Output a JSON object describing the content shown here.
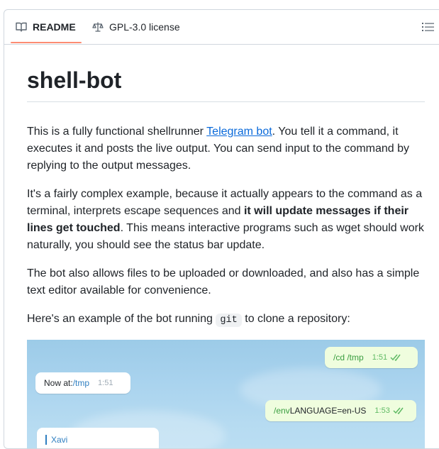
{
  "tabs": [
    {
      "label": "README",
      "icon": "book-icon",
      "active": true
    },
    {
      "label": "GPL-3.0 license",
      "icon": "scale-icon",
      "active": false
    }
  ],
  "toc_icon": "list-icon",
  "colors": {
    "accent_underline": "#fd8c73",
    "link": "#0969da",
    "text": "#1f2328"
  },
  "readme": {
    "title": "shell-bot",
    "p1": {
      "before": "This is a fully functional shellrunner ",
      "link": "Telegram bot",
      "after": ". You tell it a command, it executes it and posts the live output. You can send input to the command by replying to the output messages."
    },
    "p2": {
      "before": "It's a fairly complex example, because it actually appears to the command as a terminal, interprets escape sequences and ",
      "bold": "it will update messages if their lines get touched",
      "after": ". This means interactive programs such as wget should work naturally, you should see the status bar update."
    },
    "p3": "The bot also allows files to be uploaded or downloaded, and also has a simple text editor available for convenience.",
    "p4": {
      "before": "Here's an example of the bot running ",
      "code": "git",
      "after": " to clone a repository:"
    }
  },
  "chat": {
    "messages": [
      {
        "dir": "out",
        "cmd": "/cd /tmp",
        "time": "1:51"
      },
      {
        "dir": "in",
        "label": "Now at: ",
        "path": "/tmp",
        "time": "1:51"
      },
      {
        "dir": "out",
        "cmd": "/env",
        "text": " LANGUAGE=en-US",
        "time": "1:53"
      },
      {
        "dir": "in",
        "name": "Xavi"
      }
    ]
  }
}
